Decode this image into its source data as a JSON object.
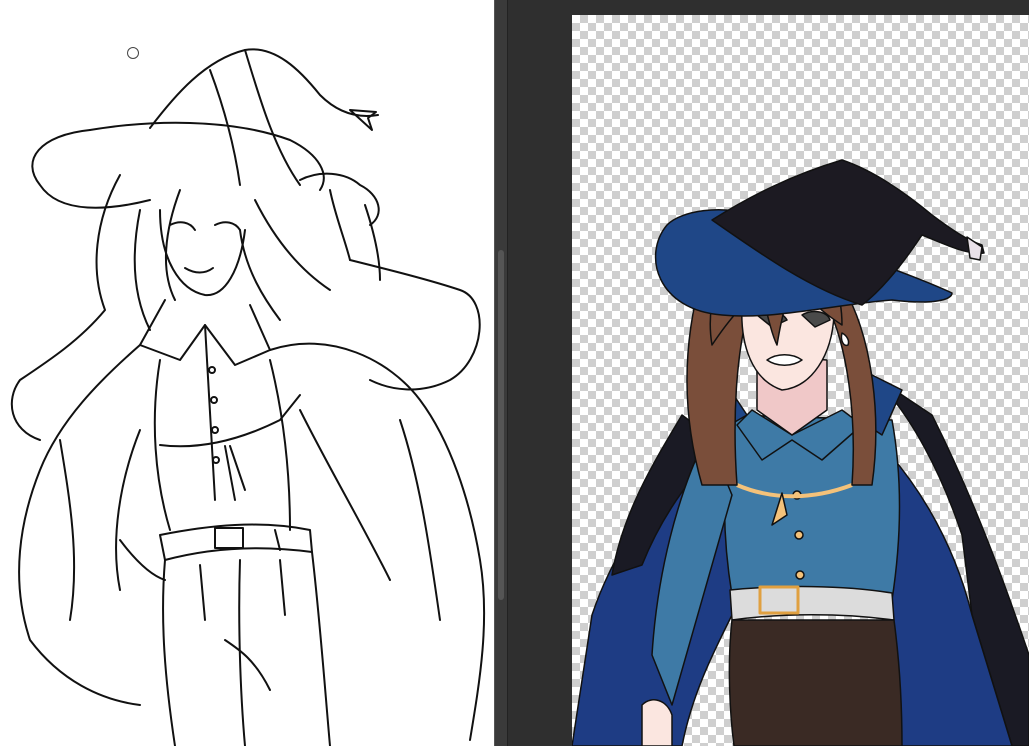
{
  "workspace": {
    "left_panel": "line-art",
    "right_panel": "flat-color",
    "colors": {
      "workspace_bg": "#2f2f2f",
      "paper": "#ffffff",
      "checker": "#cfcfcf",
      "hat": "#1c1a22",
      "brim": "#1f4787",
      "hair": "#7a4e3a",
      "shirt": "#3e7aa6",
      "cape": "#1e3c84",
      "cape_dark": "#1a1a24",
      "pants": "#3a2a24",
      "skin": "#fbe6e0",
      "belt": "#dcdcdc",
      "ribbon": "#f4c27a"
    }
  }
}
